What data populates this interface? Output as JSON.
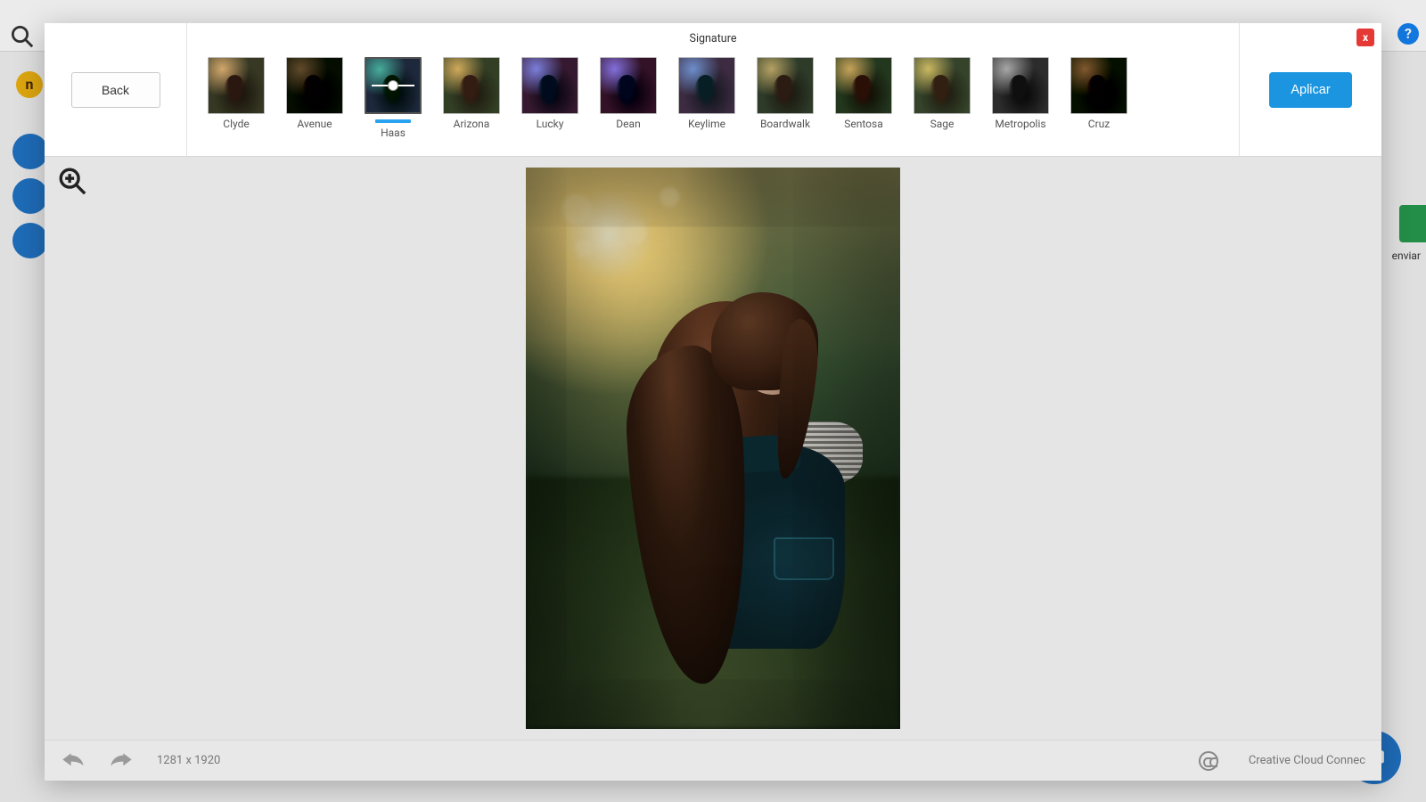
{
  "background": {
    "enviar_label": "enviar"
  },
  "modal": {
    "close_label": "x",
    "title": "Signature",
    "back_label": "Back",
    "apply_label": "Aplicar",
    "filters": [
      {
        "name": "Clyde",
        "tint": "tint-warm",
        "selected": false
      },
      {
        "name": "Avenue",
        "tint": "tint-dark",
        "selected": false
      },
      {
        "name": "Haas",
        "tint": "tint-teal",
        "selected": true
      },
      {
        "name": "Arizona",
        "tint": "tint-orange",
        "selected": false
      },
      {
        "name": "Lucky",
        "tint": "tint-blue",
        "selected": false
      },
      {
        "name": "Dean",
        "tint": "tint-blue2",
        "selected": false
      },
      {
        "name": "Keylime",
        "tint": "tint-key",
        "selected": false
      },
      {
        "name": "Boardwalk",
        "tint": "tint-board",
        "selected": false
      },
      {
        "name": "Sentosa",
        "tint": "tint-sent",
        "selected": false
      },
      {
        "name": "Sage",
        "tint": "tint-sage",
        "selected": false
      },
      {
        "name": "Metropolis",
        "tint": "tint-bw",
        "selected": false
      },
      {
        "name": "Cruz",
        "tint": "tint-cruz",
        "selected": false
      }
    ],
    "footer": {
      "dimensions": "1281 x 1920",
      "cc_label": "Creative Cloud Connec"
    }
  }
}
